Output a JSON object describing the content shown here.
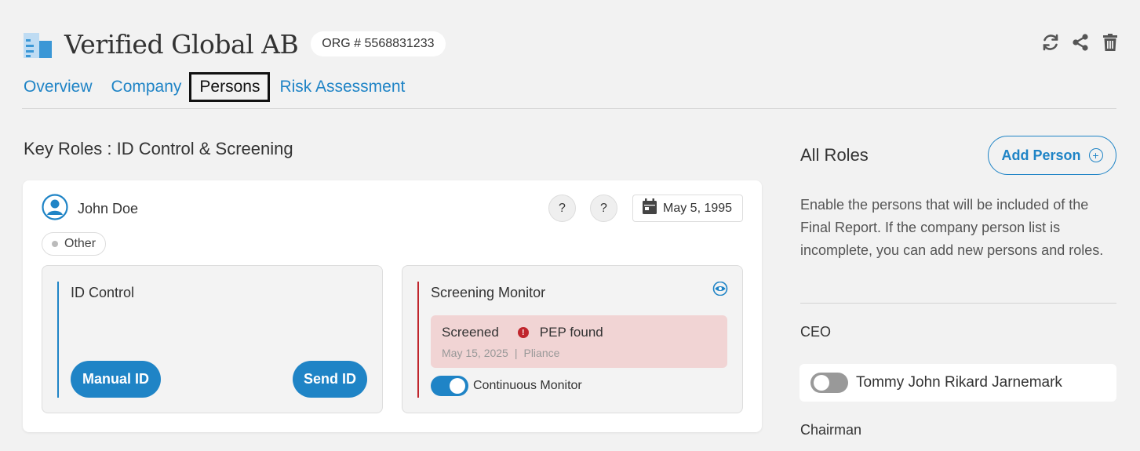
{
  "header": {
    "company_name": "Verified Global AB",
    "org_number": "ORG # 5568831233",
    "actions": [
      "refresh-icon",
      "share-icon",
      "trash-icon"
    ]
  },
  "tabs": [
    {
      "label": "Overview",
      "active": false
    },
    {
      "label": "Company",
      "active": false
    },
    {
      "label": "Persons",
      "active": true
    },
    {
      "label": "Risk Assessment",
      "active": false
    }
  ],
  "main": {
    "section_title": "Key Roles : ID Control & Screening",
    "person": {
      "name": "John Doe",
      "help1": "?",
      "help2": "?",
      "birth_date": "May 5, 1995",
      "role": "Other"
    },
    "id_control": {
      "title": "ID Control",
      "manual_button": "Manual ID",
      "send_button": "Send ID"
    },
    "screening": {
      "title": "Screening Monitor",
      "status": "Screened",
      "result": "PEP found",
      "date": "May 15, 2025",
      "separator": "|",
      "provider": "Pliance",
      "continuous_label": "Continuous Monitor",
      "continuous_on": true
    }
  },
  "sidebar": {
    "title": "All Roles",
    "add_button": "Add Person",
    "description": "Enable the persons that will be included of the Final Report. If the company person list is incomplete, you can add new persons and roles.",
    "roles": [
      {
        "heading": "CEO",
        "person": "Tommy John Rikard Jarnemark",
        "enabled": false
      },
      {
        "heading": "Chairman"
      }
    ]
  },
  "colors": {
    "accent": "#1f84c6",
    "danger": "#c0262d",
    "alert_bg": "#f1d4d4",
    "page_bg": "#f2f2f2"
  }
}
